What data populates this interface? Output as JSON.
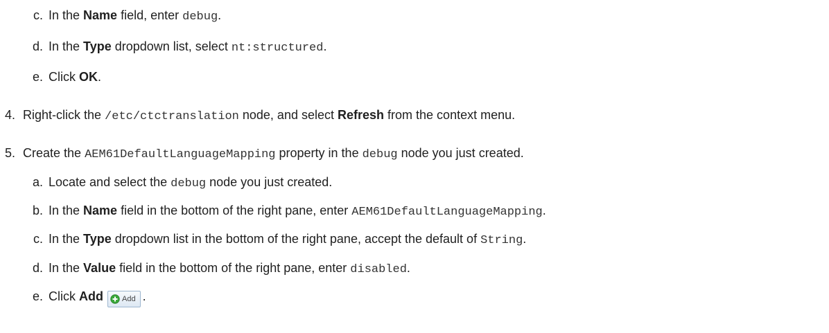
{
  "steps": {
    "c_name": {
      "marker": "c.",
      "t1": "In the ",
      "b1": "Name",
      "t2": " field, enter ",
      "code1": "debug",
      "t3": "."
    },
    "d_type": {
      "marker": "d.",
      "t1": "In the ",
      "b1": "Type",
      "t2": " dropdown list, select ",
      "code1": "nt:structured",
      "t3": "."
    },
    "e_ok": {
      "marker": "e.",
      "t1": "Click ",
      "b1": "OK",
      "t2": "."
    },
    "s4": {
      "marker": "4.",
      "t1": "Right-click the ",
      "code1": "/etc/ctctranslation",
      "t2": " node, and select ",
      "b1": "Refresh",
      "t3": " from the context menu."
    },
    "s5": {
      "marker": "5.",
      "t1": "Create the ",
      "code1": "AEM61DefaultLanguageMapping",
      "t2": " property in the ",
      "code2": "debug",
      "t3": " node you just created."
    },
    "s5a": {
      "marker": "a.",
      "t1": "Locate and select the ",
      "code1": "debug",
      "t2": " node you just created."
    },
    "s5b": {
      "marker": "b.",
      "t1": "In the ",
      "b1": "Name",
      "t2": " field in the bottom of the right pane, enter ",
      "code1": "AEM61DefaultLanguageMapping",
      "t3": "."
    },
    "s5c": {
      "marker": "c.",
      "t1": "In the ",
      "b1": "Type",
      "t2": " dropdown list in the bottom of the right pane, accept the default of ",
      "code1": "String",
      "t3": "."
    },
    "s5d": {
      "marker": "d.",
      "t1": "In the ",
      "b1": "Value",
      "t2": " field in the bottom of the right pane, enter ",
      "code1": "disabled",
      "t3": "."
    },
    "s5e": {
      "marker": "e.",
      "t1": "Click ",
      "b1": "Add",
      "button_label": "Add",
      "t2": "."
    }
  },
  "colors": {
    "text": "#1f1f1f",
    "add_icon_green": "#3aa83a",
    "button_border": "#9db6cf"
  },
  "icons": {
    "add": "plus-circle-icon"
  }
}
